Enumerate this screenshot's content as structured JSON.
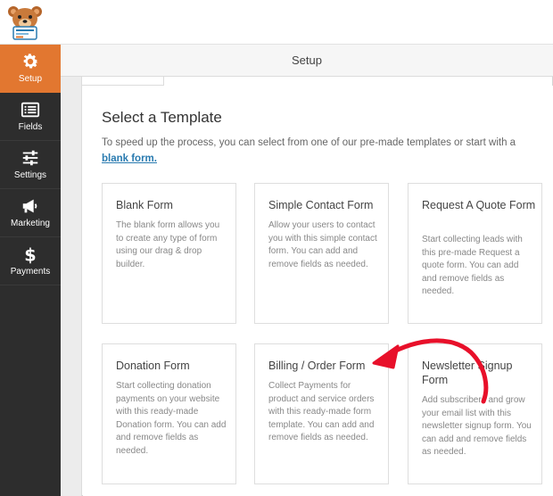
{
  "sidebar": {
    "items": [
      {
        "label": "Setup",
        "icon": "gear-icon"
      },
      {
        "label": "Fields",
        "icon": "fields-icon"
      },
      {
        "label": "Settings",
        "icon": "sliders-icon"
      },
      {
        "label": "Marketing",
        "icon": "megaphone-icon"
      },
      {
        "label": "Payments",
        "icon": "dollar-icon"
      }
    ]
  },
  "header": {
    "title": "Setup"
  },
  "main": {
    "title": "Select a Template",
    "description": "To speed up the process, you can select from one of our pre-made templates or start with a",
    "blank_link": "blank form.",
    "templates": [
      {
        "title": "Blank Form",
        "description": "The blank form allows you to create any type of form using our drag & drop builder."
      },
      {
        "title": "Simple Contact Form",
        "description": "Allow your users to contact you with this simple contact form. You can add and remove fields as needed."
      },
      {
        "title": "Request A Quote Form",
        "description": "Start collecting leads with this pre-made Request a quote form. You can add and remove fields as needed."
      },
      {
        "title": "Donation Form",
        "description": "Start collecting donation payments on your website with this ready-made Donation form. You can add and remove fields as needed."
      },
      {
        "title": "Billing / Order Form",
        "description": "Collect Payments for product and service orders with this ready-made form template. You can add and remove fields as needed."
      },
      {
        "title": "Newsletter Signup Form",
        "description": "Add subscribers and grow your email list with this newsletter signup form. You can add and remove fields as needed."
      }
    ]
  },
  "colors": {
    "accent": "#e27730",
    "sidebar": "#2d2d2d",
    "link": "#2a7bb0",
    "annotation_arrow": "#e8102a"
  }
}
